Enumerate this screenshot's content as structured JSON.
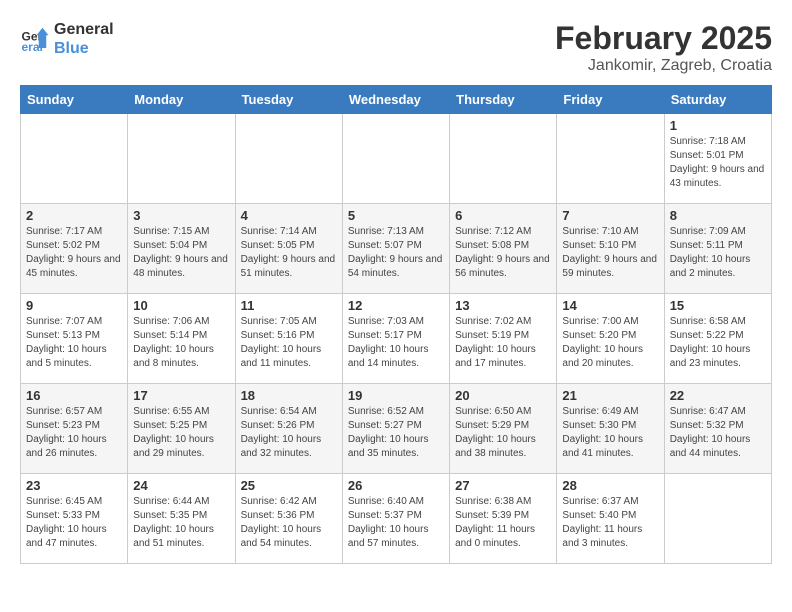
{
  "logo": {
    "line1": "General",
    "line2": "Blue"
  },
  "title": "February 2025",
  "location": "Jankomir, Zagreb, Croatia",
  "weekdays": [
    "Sunday",
    "Monday",
    "Tuesday",
    "Wednesday",
    "Thursday",
    "Friday",
    "Saturday"
  ],
  "weeks": [
    [
      {
        "day": "",
        "info": ""
      },
      {
        "day": "",
        "info": ""
      },
      {
        "day": "",
        "info": ""
      },
      {
        "day": "",
        "info": ""
      },
      {
        "day": "",
        "info": ""
      },
      {
        "day": "",
        "info": ""
      },
      {
        "day": "1",
        "info": "Sunrise: 7:18 AM\nSunset: 5:01 PM\nDaylight: 9 hours and 43 minutes."
      }
    ],
    [
      {
        "day": "2",
        "info": "Sunrise: 7:17 AM\nSunset: 5:02 PM\nDaylight: 9 hours and 45 minutes."
      },
      {
        "day": "3",
        "info": "Sunrise: 7:15 AM\nSunset: 5:04 PM\nDaylight: 9 hours and 48 minutes."
      },
      {
        "day": "4",
        "info": "Sunrise: 7:14 AM\nSunset: 5:05 PM\nDaylight: 9 hours and 51 minutes."
      },
      {
        "day": "5",
        "info": "Sunrise: 7:13 AM\nSunset: 5:07 PM\nDaylight: 9 hours and 54 minutes."
      },
      {
        "day": "6",
        "info": "Sunrise: 7:12 AM\nSunset: 5:08 PM\nDaylight: 9 hours and 56 minutes."
      },
      {
        "day": "7",
        "info": "Sunrise: 7:10 AM\nSunset: 5:10 PM\nDaylight: 9 hours and 59 minutes."
      },
      {
        "day": "8",
        "info": "Sunrise: 7:09 AM\nSunset: 5:11 PM\nDaylight: 10 hours and 2 minutes."
      }
    ],
    [
      {
        "day": "9",
        "info": "Sunrise: 7:07 AM\nSunset: 5:13 PM\nDaylight: 10 hours and 5 minutes."
      },
      {
        "day": "10",
        "info": "Sunrise: 7:06 AM\nSunset: 5:14 PM\nDaylight: 10 hours and 8 minutes."
      },
      {
        "day": "11",
        "info": "Sunrise: 7:05 AM\nSunset: 5:16 PM\nDaylight: 10 hours and 11 minutes."
      },
      {
        "day": "12",
        "info": "Sunrise: 7:03 AM\nSunset: 5:17 PM\nDaylight: 10 hours and 14 minutes."
      },
      {
        "day": "13",
        "info": "Sunrise: 7:02 AM\nSunset: 5:19 PM\nDaylight: 10 hours and 17 minutes."
      },
      {
        "day": "14",
        "info": "Sunrise: 7:00 AM\nSunset: 5:20 PM\nDaylight: 10 hours and 20 minutes."
      },
      {
        "day": "15",
        "info": "Sunrise: 6:58 AM\nSunset: 5:22 PM\nDaylight: 10 hours and 23 minutes."
      }
    ],
    [
      {
        "day": "16",
        "info": "Sunrise: 6:57 AM\nSunset: 5:23 PM\nDaylight: 10 hours and 26 minutes."
      },
      {
        "day": "17",
        "info": "Sunrise: 6:55 AM\nSunset: 5:25 PM\nDaylight: 10 hours and 29 minutes."
      },
      {
        "day": "18",
        "info": "Sunrise: 6:54 AM\nSunset: 5:26 PM\nDaylight: 10 hours and 32 minutes."
      },
      {
        "day": "19",
        "info": "Sunrise: 6:52 AM\nSunset: 5:27 PM\nDaylight: 10 hours and 35 minutes."
      },
      {
        "day": "20",
        "info": "Sunrise: 6:50 AM\nSunset: 5:29 PM\nDaylight: 10 hours and 38 minutes."
      },
      {
        "day": "21",
        "info": "Sunrise: 6:49 AM\nSunset: 5:30 PM\nDaylight: 10 hours and 41 minutes."
      },
      {
        "day": "22",
        "info": "Sunrise: 6:47 AM\nSunset: 5:32 PM\nDaylight: 10 hours and 44 minutes."
      }
    ],
    [
      {
        "day": "23",
        "info": "Sunrise: 6:45 AM\nSunset: 5:33 PM\nDaylight: 10 hours and 47 minutes."
      },
      {
        "day": "24",
        "info": "Sunrise: 6:44 AM\nSunset: 5:35 PM\nDaylight: 10 hours and 51 minutes."
      },
      {
        "day": "25",
        "info": "Sunrise: 6:42 AM\nSunset: 5:36 PM\nDaylight: 10 hours and 54 minutes."
      },
      {
        "day": "26",
        "info": "Sunrise: 6:40 AM\nSunset: 5:37 PM\nDaylight: 10 hours and 57 minutes."
      },
      {
        "day": "27",
        "info": "Sunrise: 6:38 AM\nSunset: 5:39 PM\nDaylight: 11 hours and 0 minutes."
      },
      {
        "day": "28",
        "info": "Sunrise: 6:37 AM\nSunset: 5:40 PM\nDaylight: 11 hours and 3 minutes."
      },
      {
        "day": "",
        "info": ""
      }
    ]
  ]
}
